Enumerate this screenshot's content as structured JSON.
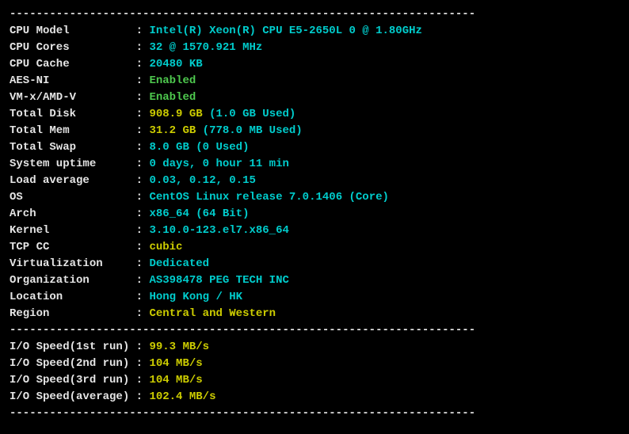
{
  "dividers": {
    "top": "----------------------------------------------------------------------",
    "mid": "----------------------------------------------------------------------",
    "bottom": "----------------------------------------------------------------------"
  },
  "sysinfo": [
    {
      "label": "CPU Model          ",
      "value": "Intel(R) Xeon(R) CPU E5-2650L 0 @ 1.80GHz",
      "vclass": "cyan"
    },
    {
      "label": "CPU Cores          ",
      "value": "32 @ 1570.921 MHz",
      "vclass": "cyan"
    },
    {
      "label": "CPU Cache          ",
      "value": "20480 KB",
      "vclass": "cyan"
    },
    {
      "label": "AES-NI             ",
      "value": "Enabled",
      "vclass": "green"
    },
    {
      "label": "VM-x/AMD-V         ",
      "value": "Enabled",
      "vclass": "green"
    },
    {
      "label": "Total Disk         ",
      "value": "908.9 GB ",
      "vclass": "yellow",
      "value2": "(1.0 GB Used)",
      "vclass2": "cyan"
    },
    {
      "label": "Total Mem          ",
      "value": "31.2 GB ",
      "vclass": "yellow",
      "value2": "(778.0 MB Used)",
      "vclass2": "cyan"
    },
    {
      "label": "Total Swap         ",
      "value": "8.0 GB ",
      "vclass": "cyan",
      "value2": "(0 Used)",
      "vclass2": "cyan"
    },
    {
      "label": "System uptime      ",
      "value": "0 days, 0 hour 11 min",
      "vclass": "cyan"
    },
    {
      "label": "Load average       ",
      "value": "0.03, 0.12, 0.15",
      "vclass": "cyan"
    },
    {
      "label": "OS                 ",
      "value": "CentOS Linux release 7.0.1406 (Core)",
      "vclass": "cyan"
    },
    {
      "label": "Arch               ",
      "value": "x86_64 (64 Bit)",
      "vclass": "cyan"
    },
    {
      "label": "Kernel             ",
      "value": "3.10.0-123.el7.x86_64",
      "vclass": "cyan"
    },
    {
      "label": "TCP CC             ",
      "value": "cubic",
      "vclass": "yellow"
    },
    {
      "label": "Virtualization     ",
      "value": "Dedicated",
      "vclass": "cyan"
    },
    {
      "label": "Organization       ",
      "value": "AS398478 PEG TECH INC",
      "vclass": "cyan"
    },
    {
      "label": "Location           ",
      "value": "Hong Kong / HK",
      "vclass": "cyan"
    },
    {
      "label": "Region             ",
      "value": "Central and Western",
      "vclass": "yellow"
    }
  ],
  "iospeed": [
    {
      "label": "I/O Speed(1st run) ",
      "value": "99.3 MB/s",
      "vclass": "yellow"
    },
    {
      "label": "I/O Speed(2nd run) ",
      "value": "104 MB/s",
      "vclass": "yellow"
    },
    {
      "label": "I/O Speed(3rd run) ",
      "value": "104 MB/s",
      "vclass": "yellow"
    },
    {
      "label": "I/O Speed(average) ",
      "value": "102.4 MB/s",
      "vclass": "yellow"
    }
  ]
}
